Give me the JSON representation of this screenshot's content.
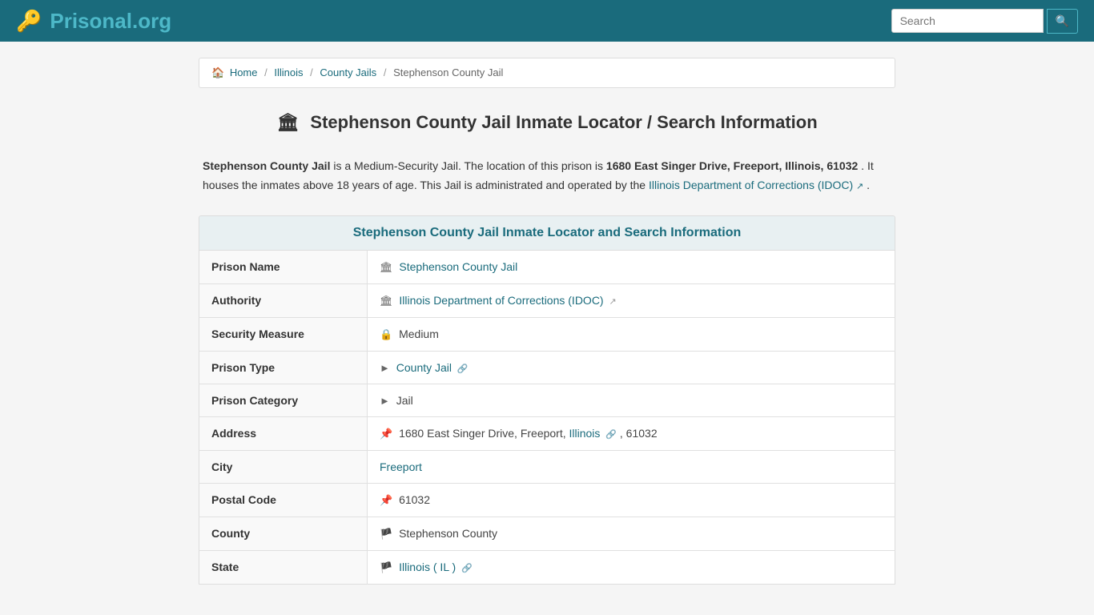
{
  "header": {
    "logo_text": "Prisonal",
    "logo_domain": ".org",
    "search_placeholder": "Search"
  },
  "breadcrumb": {
    "home": "Home",
    "level1": "Illinois",
    "level2": "County Jails",
    "level3": "Stephenson County Jail"
  },
  "page": {
    "title": "Stephenson County Jail Inmate Locator / Search Information",
    "title_icon": "🏛"
  },
  "description": {
    "jail_name": "Stephenson County Jail",
    "security_level": "Medium-Security Jail",
    "intro": " is a Medium-Security Jail. The location of this prison is ",
    "address_bold": "1680 East Singer Drive, Freeport, Illinois, 61032",
    "mid_text": ". It houses the inmates above 18 years of age. This Jail is administrated and operated by the ",
    "authority_link": "Illinois Department of Corrections (IDOC)",
    "end_text": "."
  },
  "section": {
    "header": "Stephenson County Jail Inmate Locator and Search Information"
  },
  "table": {
    "rows": [
      {
        "label": "Prison Name",
        "value": "Stephenson County Jail",
        "icon": "🏛",
        "is_link": true
      },
      {
        "label": "Authority",
        "value": "Illinois Department of Corrections (IDOC)",
        "icon": "🏛",
        "is_link": true,
        "has_ext": true
      },
      {
        "label": "Security Measure",
        "value": "Medium",
        "icon": "🔒",
        "is_link": false
      },
      {
        "label": "Prison Type",
        "value": "County Jail",
        "icon": "📍",
        "is_link": true,
        "has_link_icon": true
      },
      {
        "label": "Prison Category",
        "value": "Jail",
        "icon": "📍",
        "is_link": false
      },
      {
        "label": "Address",
        "value": "1680 East Singer Drive, Freeport, ",
        "value_link": "Illinois",
        "value_end": ", 61032",
        "icon": "📍",
        "is_mixed": true
      },
      {
        "label": "City",
        "value": "Freeport",
        "icon": "",
        "is_link": true
      },
      {
        "label": "Postal Code",
        "value": "61032",
        "icon": "📍",
        "is_link": false
      },
      {
        "label": "County",
        "value": "Stephenson County",
        "icon": "🚩",
        "is_link": false
      },
      {
        "label": "State",
        "value": "Illinois ( IL )",
        "icon": "🚩",
        "is_link": true,
        "has_link_icon": true
      }
    ]
  }
}
